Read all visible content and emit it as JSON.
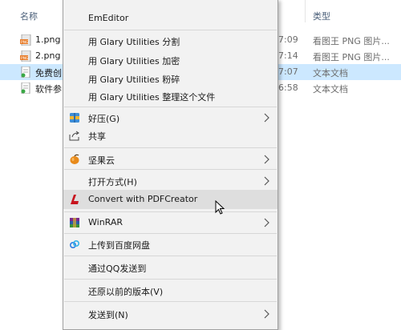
{
  "explorer": {
    "headers": {
      "name": "名称",
      "type": "类型"
    },
    "files": [
      {
        "name": "1.png",
        "time": "7:09",
        "type": "看图王 PNG 图片...",
        "icon": "png-file-icon",
        "selected": false
      },
      {
        "name": "2.png",
        "time": "7:14",
        "type": "看图王 PNG 图片...",
        "icon": "png-file-icon",
        "selected": false
      },
      {
        "name": "免费创",
        "time": "7:07",
        "type": "文本文档",
        "icon": "text-file-icon",
        "selected": true
      },
      {
        "name": "软件参",
        "time": "6:58",
        "type": "文本文档",
        "icon": "text-file-icon",
        "selected": false
      }
    ]
  },
  "menu": {
    "emeditor": "EmEditor",
    "glary_split": "用 Glary Utilities 分割",
    "glary_encrypt": "用 Glary Utilities 加密",
    "glary_shred": "用 Glary Utilities 粉碎",
    "glary_defrag": "用 Glary Utilities 整理这个文件",
    "haozip": "好压(G)",
    "share": "共享",
    "jianguoyun": "坚果云",
    "open_with": "打开方式(H)",
    "pdfcreator": "Convert with PDFCreator",
    "winrar": "WinRAR",
    "baidu": "上传到百度网盘",
    "qq": "通过QQ发送到",
    "restore": "还原以前的版本(V)",
    "send_to": "发送到(N)"
  },
  "colors": {
    "menu_bg": "#f2f2f2",
    "hover_bg": "#dedede",
    "selected_row": "#cce8ff",
    "pdf_red": "#c8141e"
  }
}
